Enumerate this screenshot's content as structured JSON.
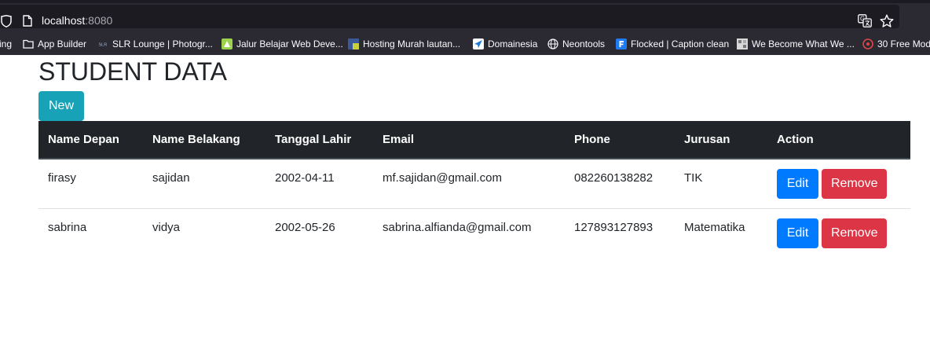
{
  "browser": {
    "url_host": "localhost",
    "url_port": ":8080",
    "bookmarks": [
      {
        "label": "ing",
        "icon": "none"
      },
      {
        "label": "App Builder",
        "icon": "folder-icon"
      },
      {
        "label": "SLR Lounge | Photogr...",
        "icon": "slr-icon"
      },
      {
        "label": "Jalur Belajar Web Deve...",
        "icon": "green-icon"
      },
      {
        "label": "Hosting Murah lautan...",
        "icon": "hosting-icon"
      },
      {
        "label": "Domainesia",
        "icon": "domainesia-icon"
      },
      {
        "label": "Neontools",
        "icon": "globe-icon"
      },
      {
        "label": "Flocked | Caption clean",
        "icon": "flocked-icon"
      },
      {
        "label": "We Become What We ...",
        "icon": "game-icon"
      },
      {
        "label": "30 Free Mod",
        "icon": "mod-icon"
      }
    ]
  },
  "page": {
    "title": "STUDENT DATA",
    "new_label": "New"
  },
  "table": {
    "headers": [
      "Name Depan",
      "Name Belakang",
      "Tanggal Lahir",
      "Email",
      "Phone",
      "Jurusan",
      "Action"
    ],
    "rows": [
      {
        "first": "firasy",
        "last": "sajidan",
        "dob": "2002-04-11",
        "email": "mf.sajidan@gmail.com",
        "phone": "082260138282",
        "major": "TIK"
      },
      {
        "first": "sabrina",
        "last": "vidya",
        "dob": "2002-05-26",
        "email": "sabrina.alfianda@gmail.com",
        "phone": "127893127893",
        "major": "Matematika"
      }
    ],
    "edit_label": "Edit",
    "remove_label": "Remove"
  },
  "colors": {
    "new_button": "#17a2b8",
    "edit_button": "#007bff",
    "remove_button": "#dc3545",
    "table_header": "#212529"
  }
}
